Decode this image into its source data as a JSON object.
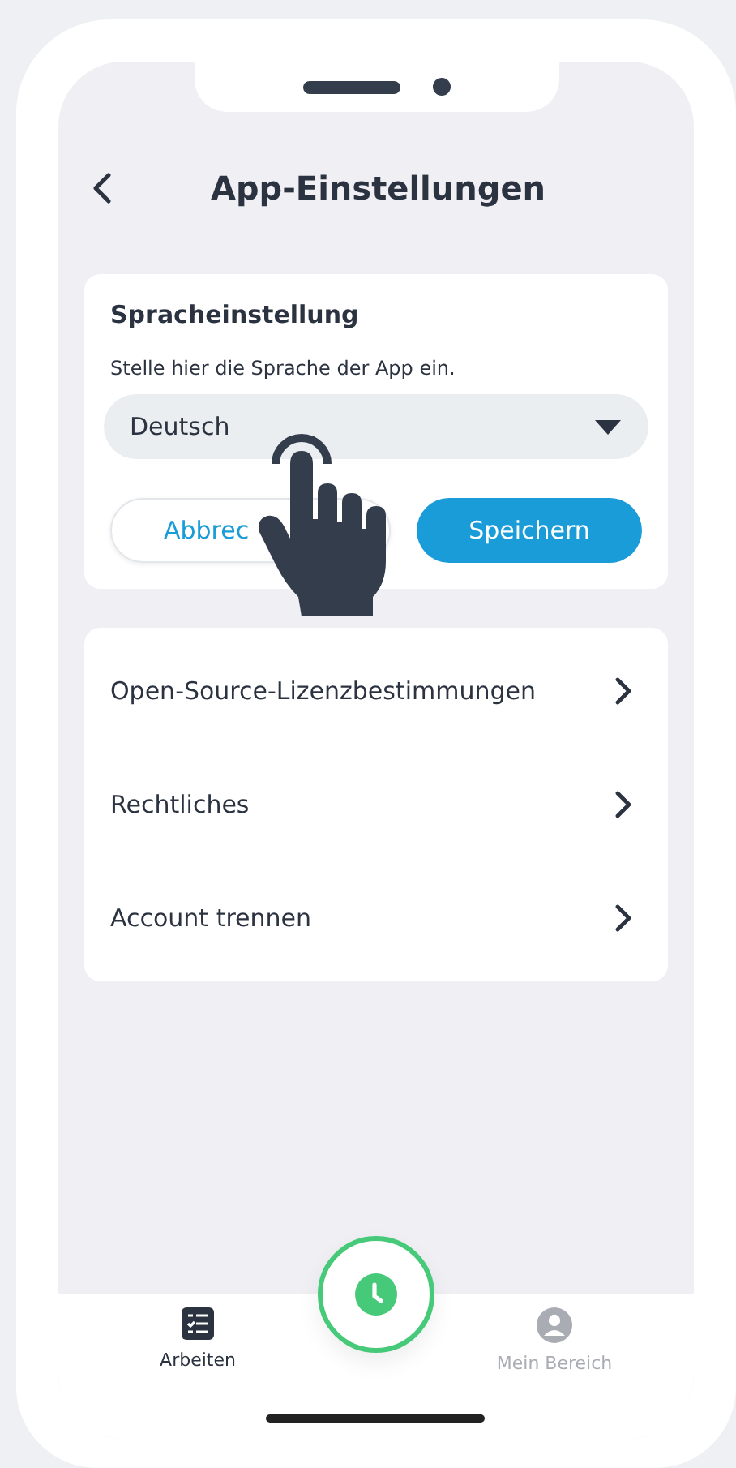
{
  "header": {
    "title": "App-Einstellungen"
  },
  "language_card": {
    "title": "Spracheinstellung",
    "description": "Stelle hier die Sprache der App ein.",
    "dropdown": {
      "value": "Deutsch"
    },
    "buttons": [
      {
        "label": "Abbrec",
        "kind": "secondary"
      },
      {
        "label": "Speichern",
        "kind": "primary"
      }
    ]
  },
  "links": [
    {
      "label": "Open-Source-Lizenzbestimmungen"
    },
    {
      "label": "Rechtliches"
    },
    {
      "label": "Account trennen"
    }
  ],
  "bottom_nav": [
    {
      "label": "Arbeiten",
      "selected": true,
      "kind": "list"
    },
    {
      "label": "Mein Bereich",
      "selected": false,
      "kind": "profile"
    }
  ]
}
